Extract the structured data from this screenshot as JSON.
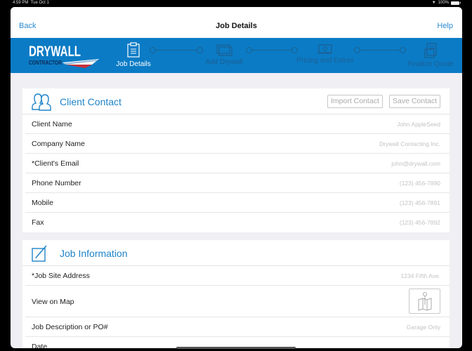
{
  "status_bar": {
    "time": "4:59 PM",
    "date": "Tue Oct 1",
    "battery": "100%"
  },
  "navbar": {
    "back_label": "Back",
    "title": "Job Details",
    "help_label": "Help"
  },
  "brand": {
    "logo_line1": "DRYWALL",
    "logo_line2": "CONTRACTOR",
    "band_color": "#0b7bc5"
  },
  "steps": [
    {
      "label": "Job Details",
      "icon": "clipboard-icon",
      "active": true
    },
    {
      "label": "Add Drywall",
      "icon": "drywall-sheets-icon",
      "active": false
    },
    {
      "label": "Pricing and Extras",
      "icon": "money-icon",
      "active": false
    },
    {
      "label": "Finalize Quote",
      "icon": "document-stack-icon",
      "active": false
    }
  ],
  "client_contact": {
    "title": "Client Contact",
    "import_label": "Import Contact",
    "save_label": "Save Contact",
    "fields": [
      {
        "label": "Client Name",
        "placeholder": "John AppleSeed"
      },
      {
        "label": "Company Name",
        "placeholder": "Drywall Contacting Inc."
      },
      {
        "label": "*Client's Email",
        "placeholder": "john@drywall.com"
      },
      {
        "label": "Phone Number",
        "placeholder": "(123) 456-7890"
      },
      {
        "label": "Mobile",
        "placeholder": "(123) 456-7891"
      },
      {
        "label": "Fax",
        "placeholder": "(123) 456-7892"
      }
    ]
  },
  "job_information": {
    "title": "Job Information",
    "fields": [
      {
        "label": "*Job Site Address",
        "placeholder": "1234 Fifth Ave."
      },
      {
        "label": "View on Map"
      },
      {
        "label": "Job Description or PO#",
        "placeholder": "Garage Only"
      },
      {
        "label": "Date",
        "placeholder": ""
      }
    ]
  }
}
